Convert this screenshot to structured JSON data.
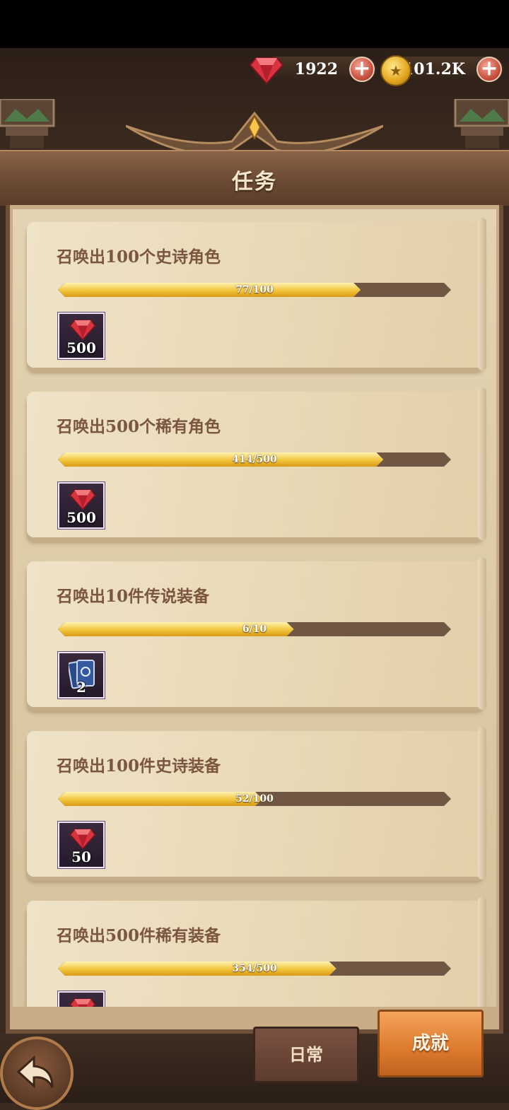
{
  "header": {
    "title": "任务",
    "gems": "1922",
    "gold": "101.2K"
  },
  "quests": [
    {
      "title": "召唤出100个史诗角色",
      "progress_text": "77/100",
      "current": 77,
      "target": 100,
      "reward_icon": "red-gem-icon",
      "reward_count": "500"
    },
    {
      "title": "召唤出500个稀有角色",
      "progress_text": "414/500",
      "current": 414,
      "target": 500,
      "reward_icon": "red-gem-icon",
      "reward_count": "500"
    },
    {
      "title": "召唤出10件传说装备",
      "progress_text": "6/10",
      "current": 6,
      "target": 10,
      "reward_icon": "summon-card-icon",
      "reward_count": "2"
    },
    {
      "title": "召唤出100件史诗装备",
      "progress_text": "52/100",
      "current": 52,
      "target": 100,
      "reward_icon": "red-gem-icon",
      "reward_count": "50"
    },
    {
      "title": "召唤出500件稀有装备",
      "progress_text": "354/500",
      "current": 354,
      "target": 500,
      "reward_icon": "red-gem-icon",
      "reward_count": ""
    }
  ],
  "tabs": {
    "daily": "日常",
    "achievements": "成就",
    "active": "achievements"
  },
  "colors": {
    "progress_fill": "#f2c43c",
    "active_tab": "#dd7a2c",
    "gem": "#d9333f"
  }
}
